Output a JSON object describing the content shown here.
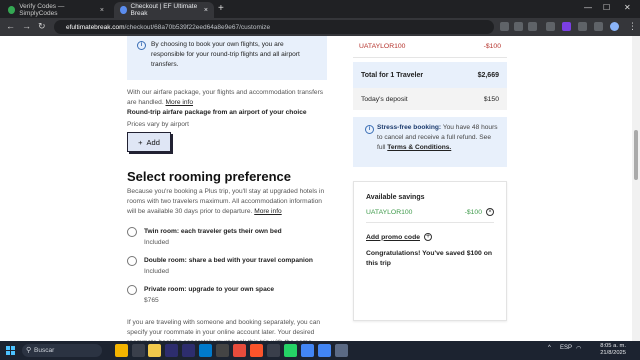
{
  "browser": {
    "tabs": [
      {
        "label": "Verify Codes — SimplyCodes",
        "color": "#34a853"
      },
      {
        "label": "Checkout | EF Ultimate Break",
        "color": "#5b8def"
      }
    ],
    "url_host": "efultimatebreak.com",
    "url_path": "/checkout/68a70b539f22eed64a8e9e67/customize"
  },
  "left": {
    "info_text": "By choosing to book your own flights, you are responsible for your round-trip flights and all airport transfers.",
    "airfare_note": "With our airfare package, your flights and accommodation transfers are handled.",
    "airfare_more": "More info",
    "airfare_title": "Round-trip airfare package from an airport of your choice",
    "airfare_prices": "Prices vary by airport",
    "add_button": "Add",
    "rooming_title": "Select rooming preference",
    "rooming_desc": "Because you're booking a Plus trip, you'll stay at upgraded hotels in rooms with two travelers maximum. All accommodation information will be available 30 days prior to departure.",
    "rooming_more": "More info",
    "options": [
      {
        "label": "Twin room: each traveler gets their own bed",
        "sub": "Included"
      },
      {
        "label": "Double room: share a bed with your travel companion",
        "sub": "Included"
      },
      {
        "label": "Private room: upgrade to your own space",
        "sub": "$765"
      }
    ],
    "bottom_text": "If you are traveling with someone and booking separately, you can specify your roommate in your online account later. Your desired roommate booking separately must book this trip with the same"
  },
  "right": {
    "promo_code": "UATAYLOR100",
    "promo_amount": "-$100",
    "total_label": "Total for 1 Traveler",
    "total_amount": "$2,669",
    "deposit_label": "Today's deposit",
    "deposit_amount": "$150",
    "stress_title": "Stress-free booking:",
    "stress_text": "You have 48 hours to cancel and receive a full refund. See full",
    "stress_link": "Terms & Conditions.",
    "savings_title": "Available savings",
    "savings_code": "UATAYLOR100",
    "savings_amount": "-$100",
    "add_promo": "Add promo code",
    "congrats": "Congratulations! You've saved $100 on this trip"
  },
  "taskbar": {
    "search_placeholder": "Buscar",
    "lang": "ESP",
    "time": "8:05 a. m.",
    "date": "21/8/2025"
  }
}
